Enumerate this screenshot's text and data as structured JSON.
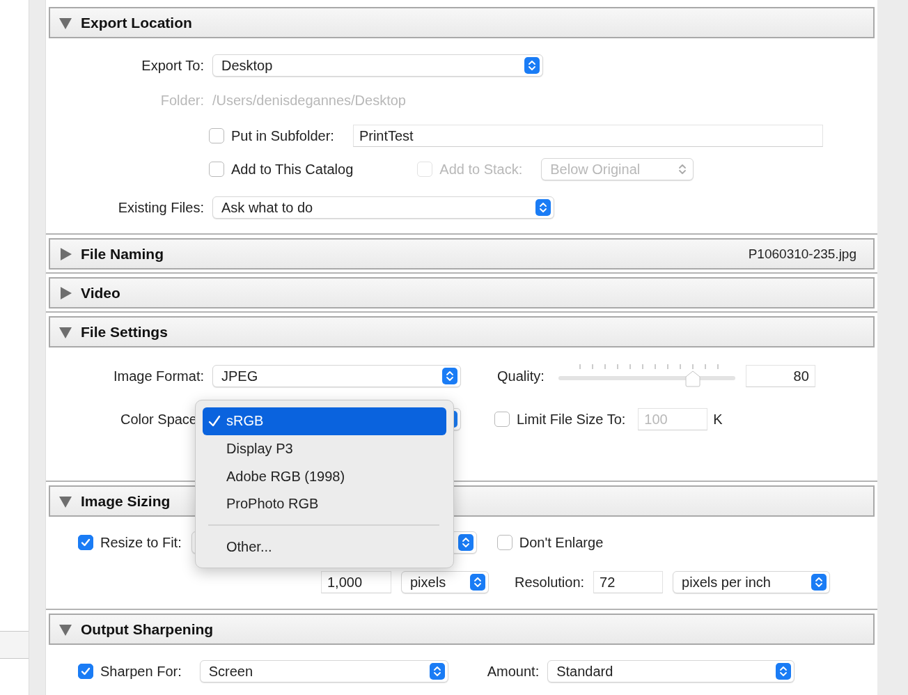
{
  "sections": [
    {
      "kind": "export_location",
      "title": "Export Location",
      "expanded": true,
      "export_to": {
        "label": "Export To:",
        "value": "Desktop"
      },
      "folder": {
        "label": "Folder:",
        "value": "/Users/denisdegannes/Desktop",
        "disabled": true
      },
      "subfolder": {
        "label": "Put in Subfolder:",
        "checked": false,
        "value": "PrintTest"
      },
      "add_to_catalog": {
        "label": "Add to This Catalog",
        "checked": false
      },
      "add_to_stack": {
        "label": "Add to Stack:",
        "checked": false,
        "disabled": true,
        "value": "Below Original"
      },
      "existing_files": {
        "label": "Existing Files:",
        "value": "Ask what to do"
      }
    },
    {
      "title": "File Naming",
      "expanded": false,
      "summary": "P1060310-235.jpg"
    },
    {
      "title": "Video",
      "expanded": false
    },
    {
      "kind": "file_settings",
      "title": "File Settings",
      "expanded": true,
      "image_format": {
        "label": "Image Format:",
        "value": "JPEG"
      },
      "quality": {
        "label": "Quality:",
        "level": 0.76,
        "value": "80"
      },
      "color_space": {
        "label": "Color Space"
      },
      "limit_file_size": {
        "label": "Limit File Size To:",
        "checked": false,
        "value": "100",
        "unit": "K"
      }
    },
    {
      "kind": "image_sizing",
      "title": "Image Sizing",
      "expanded": true,
      "resize_to_fit": {
        "label": "Resize to Fit:",
        "checked": true
      },
      "dont_enlarge": {
        "label": "Don't Enlarge",
        "checked": false
      },
      "size": {
        "value": "1,000",
        "unit": "pixels"
      },
      "resolution": {
        "label": "Resolution:",
        "value": "72",
        "unit": "pixels per inch"
      }
    },
    {
      "kind": "output_sharpening",
      "title": "Output Sharpening",
      "expanded": true,
      "sharpen_for": {
        "label": "Sharpen For:",
        "checked": true,
        "value": "Screen"
      },
      "amount": {
        "label": "Amount:",
        "value": "Standard"
      }
    }
  ],
  "color_menu": {
    "items": [
      {
        "label": "sRGB",
        "selected": true
      },
      {
        "label": "Display P3",
        "selected": false
      },
      {
        "label": "Adobe RGB (1998)",
        "selected": false
      },
      {
        "label": "ProPhoto RGB",
        "selected": false
      }
    ],
    "other": "Other..."
  }
}
